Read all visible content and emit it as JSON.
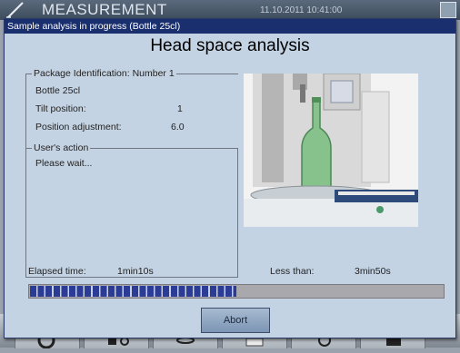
{
  "background": {
    "title": "MEASUREMENT",
    "datetime": "11.10.2011   10:41:00"
  },
  "dialog": {
    "titlebar": "Sample analysis in progress (Bottle 25cl)",
    "heading": "Head space analysis"
  },
  "package": {
    "legend": "Package Identification: Number 1",
    "name": "Bottle 25cl",
    "tilt_label": "Tilt position:",
    "tilt_value": "1",
    "adjust_label": "Position adjustment:",
    "adjust_value": "6.0"
  },
  "action": {
    "legend": "User's action",
    "message": "Please wait..."
  },
  "timing": {
    "elapsed_label": "Elapsed time:",
    "elapsed_value": "1min10s",
    "remaining_label": "Less than:",
    "remaining_value": "3min50s",
    "progress_fraction": 0.5
  },
  "buttons": {
    "abort": "Abort"
  },
  "colors": {
    "titlebar": "#1a2f6e",
    "dialog_bg": "#c4d3e3",
    "progress": "#2a3c96"
  }
}
